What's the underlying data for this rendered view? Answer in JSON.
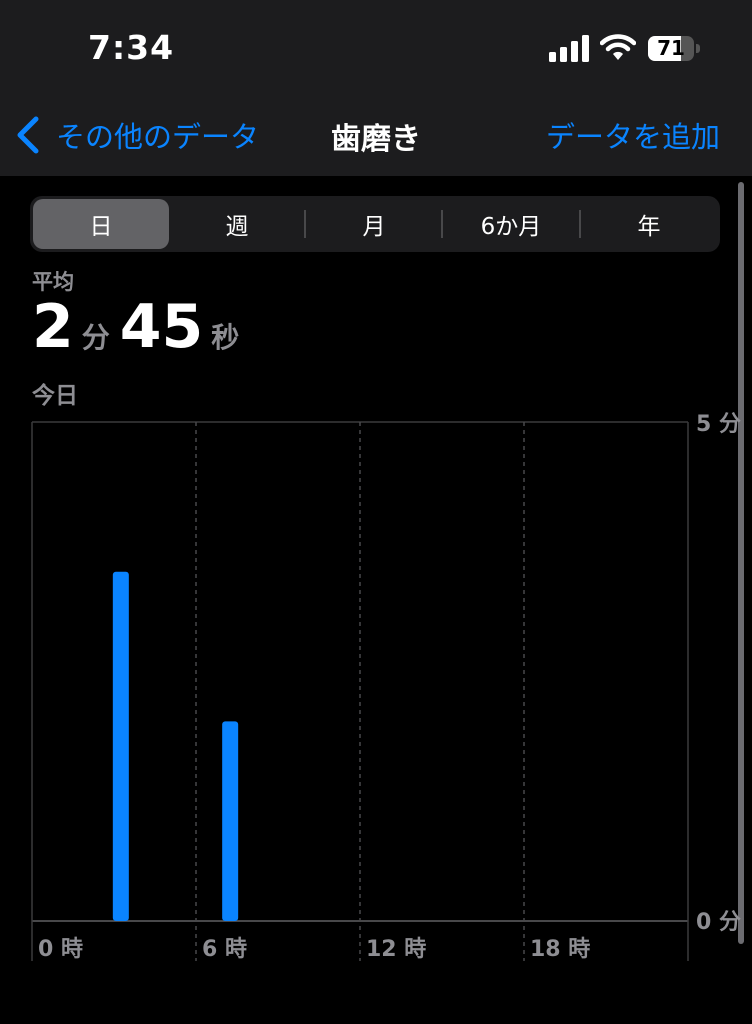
{
  "status_bar": {
    "time": "7:34",
    "battery": "71",
    "battery_level": 0.71
  },
  "nav": {
    "back_label": "その他のデータ",
    "title": "歯磨き",
    "add_label": "データを追加"
  },
  "segments": [
    {
      "label": "日",
      "active": true
    },
    {
      "label": "週",
      "active": false
    },
    {
      "label": "月",
      "active": false
    },
    {
      "label": "6か月",
      "active": false
    },
    {
      "label": "年",
      "active": false
    }
  ],
  "summary": {
    "avg_label": "平均",
    "minutes": "2",
    "minutes_unit": "分",
    "seconds": "45",
    "seconds_unit": "秒",
    "date_label": "今日"
  },
  "colors": {
    "accent": "#0a84ff",
    "bar": "#0a84ff"
  },
  "chart_data": {
    "type": "bar",
    "x_ticks": [
      "0 時",
      "6 時",
      "12 時",
      "18 時"
    ],
    "y_ticks": [
      "5 分",
      "0 分"
    ],
    "ylim": [
      0,
      5
    ],
    "xlim": [
      0,
      24
    ],
    "bars": [
      {
        "hour": 3.25,
        "value": 3.5
      },
      {
        "hour": 7.25,
        "value": 2.0
      }
    ]
  }
}
